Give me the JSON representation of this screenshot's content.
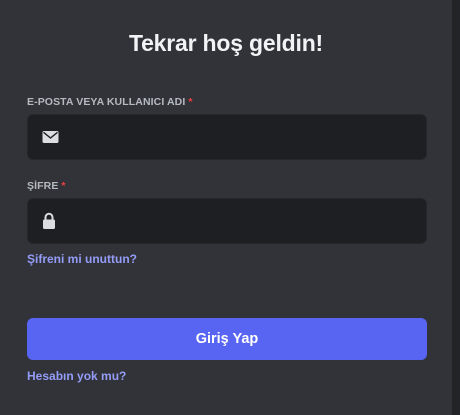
{
  "form": {
    "title": "Tekrar hoş geldin!",
    "email": {
      "label": "E-POSTA VEYA KULLANICI ADI",
      "required_mark": "*",
      "value": "",
      "placeholder": "",
      "icon": "envelope-icon"
    },
    "password": {
      "label": "ŞİFRE",
      "required_mark": "*",
      "value": "",
      "placeholder": "",
      "icon": "lock-icon"
    },
    "forgot_password_link": "Şifreni mi unuttun?",
    "submit_label": "Giriş Yap",
    "register_link": "Hesabın yok mu?"
  },
  "colors": {
    "background": "#313338",
    "input_background": "#1e1f22",
    "accent": "#5865f2",
    "link": "#949cf7",
    "required": "#f23f42"
  }
}
